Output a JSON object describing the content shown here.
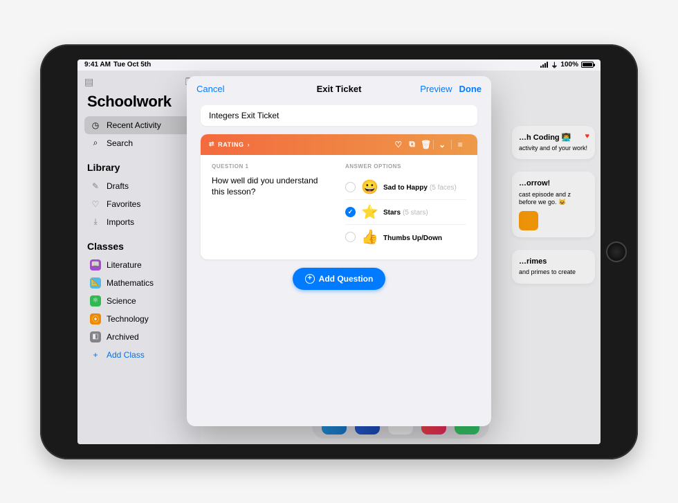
{
  "status": {
    "time": "9:41 AM",
    "date": "Tue Oct 5th",
    "battery": "100%"
  },
  "app_title": "Schoolwork",
  "sidebar": {
    "items": [
      {
        "icon": "◷",
        "label": "Recent Activity",
        "active": true
      },
      {
        "icon": "⌕",
        "label": "Search"
      }
    ],
    "section_library": "Library",
    "library": [
      {
        "icon": "✎",
        "label": "Drafts"
      },
      {
        "icon": "♡",
        "label": "Favorites"
      },
      {
        "icon": "⤓",
        "label": "Imports"
      }
    ],
    "section_classes": "Classes",
    "classes": [
      {
        "cls": "ic-purple",
        "icon": "📖",
        "label": "Literature"
      },
      {
        "cls": "ic-blue",
        "icon": "📐",
        "label": "Mathematics"
      },
      {
        "cls": "ic-green",
        "icon": "⚛",
        "label": "Science"
      },
      {
        "cls": "ic-orange",
        "icon": "⦿",
        "label": "Technology"
      },
      {
        "cls": "ic-grey",
        "icon": "◧",
        "label": "Archived"
      }
    ],
    "add_class": "Add Class"
  },
  "background_cards": [
    {
      "title": "…h Coding 👨‍💻",
      "text": "activity and of your work!",
      "heart": true
    },
    {
      "title": "…orrow!",
      "text": "cast episode and z before we go. 🐱"
    },
    {
      "title": "…rimes",
      "text": "and primes to create"
    }
  ],
  "sheet": {
    "cancel": "Cancel",
    "title": "Exit Ticket",
    "preview": "Preview",
    "done": "Done",
    "ticket_title": "Integers Exit Ticket",
    "rating_label": "RATING",
    "question_label": "QUESTION 1",
    "question_text": "How well did you understand this lesson?",
    "answer_label": "ANSWER OPTIONS",
    "options": [
      {
        "emoji": "😀",
        "label": "Sad to Happy",
        "hint": "(5 faces)",
        "checked": false
      },
      {
        "emoji": "⭐",
        "label": "Stars",
        "hint": "(5 stars)",
        "checked": true
      },
      {
        "emoji": "👍",
        "label": "Thumbs Up/Down",
        "hint": "",
        "checked": false
      }
    ],
    "add_question": "Add Question"
  },
  "dock_colors": [
    "linear-gradient(135deg,#2bb0f5,#1c7bd8)",
    "linear-gradient(135deg,#2f6df2,#1e4dc0)",
    "#fff",
    "linear-gradient(135deg,#ff5e3a,#ff2a68)",
    "linear-gradient(135deg,#4cd964,#2ecc71)"
  ]
}
